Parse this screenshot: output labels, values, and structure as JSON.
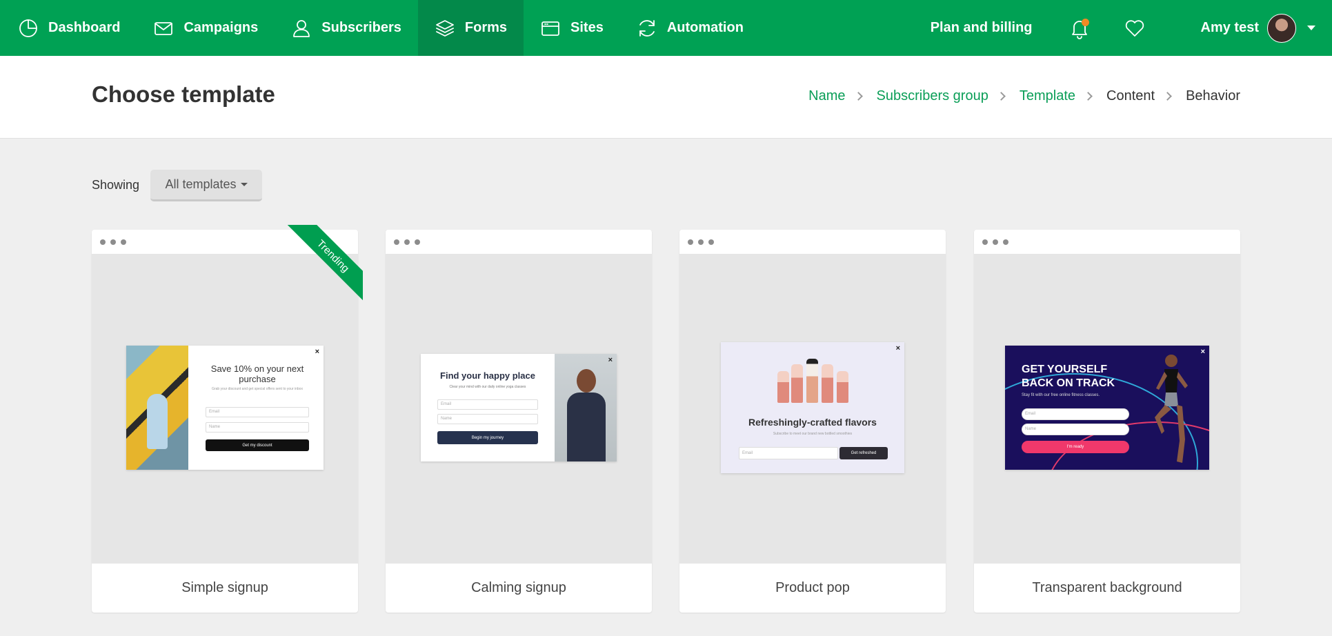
{
  "nav": {
    "items": [
      {
        "label": "Dashboard",
        "icon": "dashboard-icon"
      },
      {
        "label": "Campaigns",
        "icon": "envelope-icon"
      },
      {
        "label": "Subscribers",
        "icon": "user-icon"
      },
      {
        "label": "Forms",
        "icon": "layers-icon",
        "active": true
      },
      {
        "label": "Sites",
        "icon": "browser-window-icon"
      },
      {
        "label": "Automation",
        "icon": "refresh-icon"
      }
    ],
    "plan_label": "Plan and billing",
    "user_name": "Amy test"
  },
  "header": {
    "title": "Choose template",
    "breadcrumb": [
      {
        "label": "Name",
        "state": "done"
      },
      {
        "label": "Subscribers group",
        "state": "done"
      },
      {
        "label": "Template",
        "state": "done"
      },
      {
        "label": "Content",
        "state": "todo"
      },
      {
        "label": "Behavior",
        "state": "todo"
      }
    ]
  },
  "filter": {
    "showing_label": "Showing",
    "selected": "All templates"
  },
  "colors": {
    "brand_green": "#00a154",
    "active_nav": "#03894a",
    "link_green": "#0a9e57",
    "notification": "#f08a24"
  },
  "templates": [
    {
      "name": "Simple signup",
      "ribbon": "Trending",
      "preview": {
        "close": "×",
        "heading": "Save 10% on your next purchase",
        "subtext": "Grab your discount and get special offers sent to your inbox",
        "field1": "Email",
        "field2": "Name",
        "button": "Get my discount"
      }
    },
    {
      "name": "Calming signup",
      "preview": {
        "close": "×",
        "heading": "Find your happy place",
        "subtext": "Clear your mind with our daily online yoga classes",
        "field1": "Email",
        "field2": "Name",
        "button": "Begin my journey"
      }
    },
    {
      "name": "Product pop",
      "preview": {
        "close": "×",
        "heading": "Refreshingly-crafted flavors",
        "subtext": "Subscribe to meet our brand new bottled smoothies",
        "field1": "Email",
        "button": "Get refreshed"
      }
    },
    {
      "name": "Transparent background",
      "preview": {
        "close": "×",
        "heading_line1": "GET YOURSELF",
        "heading_line2": "BACK ON TRACK",
        "subtext": "Stay fit with our free online fitness classes.",
        "field1": "Email",
        "field2": "Name",
        "button": "I'm ready"
      }
    }
  ]
}
